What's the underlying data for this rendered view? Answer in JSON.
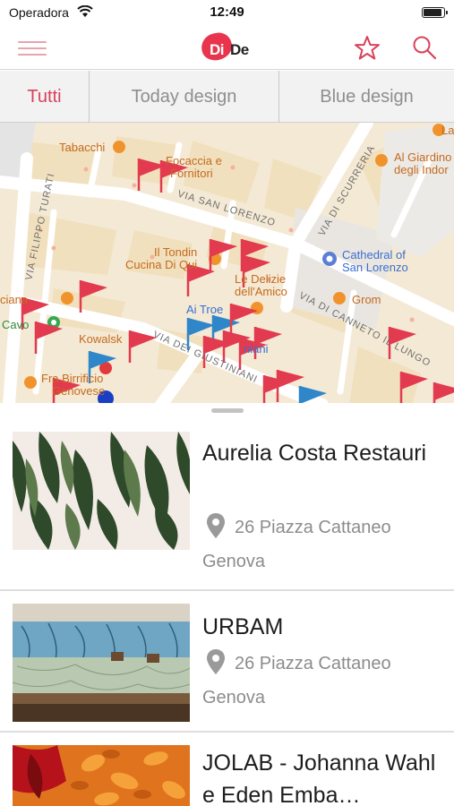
{
  "status": {
    "carrier": "Operadora",
    "time": "12:49"
  },
  "nav": {
    "logo_di": "Di",
    "logo_de": "De"
  },
  "tabs": [
    {
      "label": "Tutti",
      "active": true
    },
    {
      "label": "Today design",
      "active": false
    },
    {
      "label": "Blue design",
      "active": false
    }
  ],
  "map": {
    "labels": {
      "tabacchi": "Tabacchi",
      "focaccia1": "Focaccia e",
      "focaccia2": "Fornitori",
      "giardino1": "Al Giardino",
      "giardino2": "degli Indor",
      "la": "La",
      "tondin1": "Il Tondin",
      "tondin2": "Cucina Di Qui",
      "delizie1": "Le Delizie",
      "delizie2": "dell'Amico",
      "cathedral1": "Cathedral of",
      "cathedral2": "San Lorenzo",
      "grom": "Grom",
      "aitroe": "Ai Troe",
      "kowalsk": "Kowalsk",
      "ciana": "ciana",
      "cavo": "Cavo",
      "birrificio1": "Fra Birrificio",
      "birrificio2": "Genovese",
      "niani": "niani",
      "via_scurreria": "VIA DI SCURRERIA",
      "via_san_lorenzo": "VIA SAN LORENZO",
      "via_filippo_turati": "VIA FILIPPO TURATI",
      "via_canneto": "VIA DI CANNETO IL LUNGO",
      "via_giustiniani": "VIA DEI GIUSTINIANI"
    }
  },
  "places": [
    {
      "title": " Aurelia Costa Restauri",
      "address": "26 Piazza Cattaneo",
      "city": "Genova"
    },
    {
      "title": "URBAM",
      "address": "26 Piazza Cattaneo",
      "city": "Genova"
    },
    {
      "title": "JOLAB - Johanna Wahl  e Eden Emba…",
      "address": "",
      "city": ""
    }
  ],
  "colors": {
    "accent": "#d9415a",
    "flag_red": "#e23a4f",
    "flag_blue": "#2f86c9",
    "brand": "#e8354d"
  },
  "icons": [
    "menu-icon",
    "star-icon",
    "search-icon",
    "location-pin-icon",
    "wifi-icon",
    "battery-icon"
  ]
}
